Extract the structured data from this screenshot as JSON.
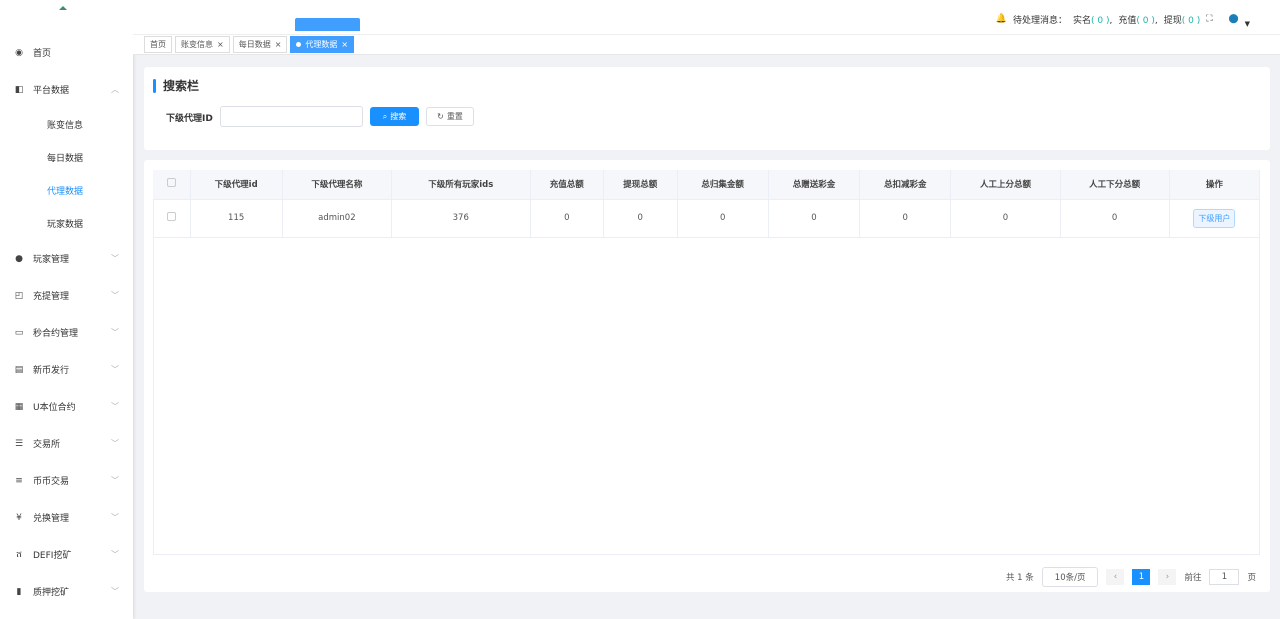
{
  "sidebar": {
    "items": [
      {
        "label": "首页",
        "icon": "dashboard-icon",
        "glyph": "◉"
      },
      {
        "label": "平台数据",
        "icon": "book-icon",
        "glyph": "◧",
        "expanded": true,
        "children": [
          "账变信息",
          "每日数据",
          "代理数据",
          "玩家数据"
        ]
      },
      {
        "label": "玩家管理",
        "icon": "user-icon",
        "glyph": "●"
      },
      {
        "label": "充提管理",
        "icon": "copy-icon",
        "glyph": "◰"
      },
      {
        "label": "秒合约管理",
        "icon": "monitor-icon",
        "glyph": "▭"
      },
      {
        "label": "新币发行",
        "icon": "card-icon",
        "glyph": "▤"
      },
      {
        "label": "U本位合约",
        "icon": "grid-icon",
        "glyph": "▦"
      },
      {
        "label": "交易所",
        "icon": "list-icon",
        "glyph": "☰"
      },
      {
        "label": "币币交易",
        "icon": "list-ul-icon",
        "glyph": "≡"
      },
      {
        "label": "兑换管理",
        "icon": "yen-icon",
        "glyph": "¥"
      },
      {
        "label": "DEFI挖矿",
        "icon": "person-icon",
        "glyph": "ሸ"
      },
      {
        "label": "质押挖矿",
        "icon": "bar-chart-icon",
        "glyph": "▮"
      }
    ]
  },
  "tabs": [
    {
      "label": "首页"
    },
    {
      "label": "账变信息"
    },
    {
      "label": "每日数据"
    },
    {
      "label": "代理数据",
      "active": true
    }
  ],
  "header": {
    "notice_label": "待处理消息：",
    "items": [
      {
        "label": "实名",
        "count": "( 0 )"
      },
      {
        "label": "充值",
        "count": "( 0 )"
      },
      {
        "label": "提现",
        "count": "( 0 )"
      }
    ]
  },
  "search": {
    "title": "搜索栏",
    "field_label": "下级代理ID",
    "field_value": "",
    "search_label": "搜索",
    "reset_label": "重置"
  },
  "table": {
    "columns": [
      "下级代理id",
      "下级代理名称",
      "下级所有玩家ids",
      "充值总额",
      "提现总额",
      "总归集金额",
      "总赠送彩金",
      "总扣减彩金",
      "人工上分总额",
      "人工下分总额",
      "操作"
    ],
    "rows": [
      [
        "115",
        "admin02",
        "376",
        "0",
        "0",
        "0",
        "0",
        "0",
        "0",
        "0"
      ]
    ],
    "row_action": "下级用户"
  },
  "pager": {
    "total": "共 1 条",
    "size": "10条/页",
    "current": "1",
    "goto": "前往",
    "goto_value": "1",
    "page_unit": "页"
  }
}
